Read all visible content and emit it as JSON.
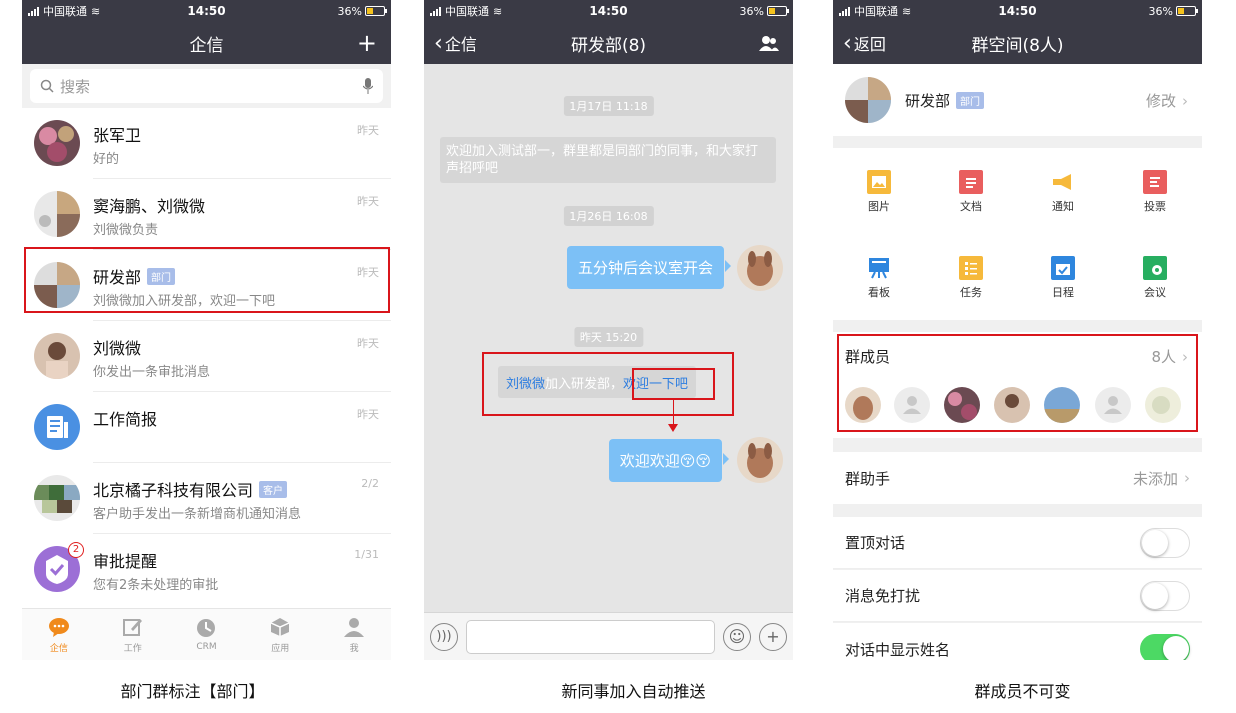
{
  "status": {
    "carrier": "中国联通",
    "time": "14:50",
    "battery": "36%",
    "battery_level": 0.36
  },
  "screen1": {
    "nav_title": "企信",
    "nav_plus": "+",
    "search_placeholder": "搜索",
    "chats": [
      {
        "name": "张军卫",
        "preview": "好的",
        "time": "昨天"
      },
      {
        "name": "窦海鹏、刘微微",
        "preview": "刘微微负责",
        "time": "昨天"
      },
      {
        "name": "研发部",
        "tag": "部门",
        "preview": "刘微微加入研发部，欢迎一下吧",
        "time": "昨天"
      },
      {
        "name": "刘微微",
        "preview": "你发出一条审批消息",
        "time": "昨天"
      },
      {
        "name": "工作简报",
        "preview": "",
        "time": "昨天"
      },
      {
        "name": "北京橘子科技有限公司",
        "tag": "客户",
        "preview": "客户助手发出一条新增商机通知消息",
        "time": "2/2"
      },
      {
        "name": "审批提醒",
        "preview": "您有2条未处理的审批",
        "time": "1/31",
        "badge": "2"
      }
    ],
    "tabs": [
      {
        "label": "企信",
        "icon": "chat-bubble-icon",
        "active": true
      },
      {
        "label": "工作",
        "icon": "edit-icon"
      },
      {
        "label": "CRM",
        "icon": "clock-icon"
      },
      {
        "label": "应用",
        "icon": "cube-icon"
      },
      {
        "label": "我",
        "icon": "person-icon"
      }
    ]
  },
  "screen2": {
    "back_label": "企信",
    "nav_title": "研发部(8)",
    "timestamps": [
      "1月17日 11:18",
      "1月26日 16:08",
      "昨天 15:20"
    ],
    "welcome_text": "欢迎加入测试部一，群里都是同部门的同事，和大家打声招呼吧",
    "bubble1": "五分钟后会议室开会",
    "join_name": "刘微微",
    "join_mid": "加入研发部，",
    "join_link": "欢迎一下吧",
    "bubble2": "欢迎欢迎😚😚"
  },
  "screen3": {
    "back_label": "返回",
    "nav_title": "群空间(8人)",
    "group_name": "研发部",
    "group_tag": "部门",
    "edit_label": "修改",
    "grid": [
      {
        "label": "图片",
        "icon": "image-icon",
        "color": "#f6b93b"
      },
      {
        "label": "文档",
        "icon": "document-icon",
        "color": "#e95e5e"
      },
      {
        "label": "通知",
        "icon": "megaphone-icon",
        "color": "#f6b93b"
      },
      {
        "label": "投票",
        "icon": "vote-icon",
        "color": "#e95e5e"
      },
      {
        "label": "看板",
        "icon": "board-icon",
        "color": "#2e86de"
      },
      {
        "label": "任务",
        "icon": "task-icon",
        "color": "#f6b93b"
      },
      {
        "label": "日程",
        "icon": "calendar-icon",
        "color": "#2e86de"
      },
      {
        "label": "会议",
        "icon": "meeting-icon",
        "color": "#27ae60"
      }
    ],
    "members_label": "群成员",
    "members_count": "8人",
    "assistant_label": "群助手",
    "assistant_value": "未添加",
    "settings": [
      {
        "label": "置顶对话",
        "on": false
      },
      {
        "label": "消息免打扰",
        "on": false
      },
      {
        "label": "对话中显示姓名",
        "on": true
      }
    ]
  },
  "captions": [
    "部门群标注【部门】",
    "新同事加入自动推送",
    "群成员不可变"
  ],
  "colors": {
    "nav": "#3a3a45",
    "bubble": "#7cc0f6",
    "highlight": "#d9151b",
    "accent": "#f08a1c",
    "toggle_on": "#4cd964"
  }
}
